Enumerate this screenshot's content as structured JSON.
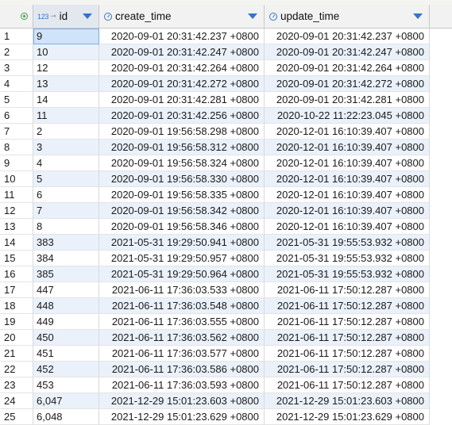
{
  "columns": [
    {
      "name": "id",
      "type_badge": "123"
    },
    {
      "name": "create_time"
    },
    {
      "name": "update_time"
    }
  ],
  "rows": [
    {
      "n": "1",
      "id": "9",
      "create": "2020-09-01 20:31:42.237 +0800",
      "update": "2020-09-01 20:31:42.237 +0800"
    },
    {
      "n": "2",
      "id": "10",
      "create": "2020-09-01 20:31:42.247 +0800",
      "update": "2020-09-01 20:31:42.247 +0800"
    },
    {
      "n": "3",
      "id": "12",
      "create": "2020-09-01 20:31:42.264 +0800",
      "update": "2020-09-01 20:31:42.264 +0800"
    },
    {
      "n": "4",
      "id": "13",
      "create": "2020-09-01 20:31:42.272 +0800",
      "update": "2020-09-01 20:31:42.272 +0800"
    },
    {
      "n": "5",
      "id": "14",
      "create": "2020-09-01 20:31:42.281 +0800",
      "update": "2020-09-01 20:31:42.281 +0800"
    },
    {
      "n": "6",
      "id": "11",
      "create": "2020-09-01 20:31:42.256 +0800",
      "update": "2020-10-22 11:22:23.045 +0800"
    },
    {
      "n": "7",
      "id": "2",
      "create": "2020-09-01 19:56:58.298 +0800",
      "update": "2020-12-01 16:10:39.407 +0800"
    },
    {
      "n": "8",
      "id": "3",
      "create": "2020-09-01 19:56:58.312 +0800",
      "update": "2020-12-01 16:10:39.407 +0800"
    },
    {
      "n": "9",
      "id": "4",
      "create": "2020-09-01 19:56:58.324 +0800",
      "update": "2020-12-01 16:10:39.407 +0800"
    },
    {
      "n": "10",
      "id": "5",
      "create": "2020-09-01 19:56:58.330 +0800",
      "update": "2020-12-01 16:10:39.407 +0800"
    },
    {
      "n": "11",
      "id": "6",
      "create": "2020-09-01 19:56:58.335 +0800",
      "update": "2020-12-01 16:10:39.407 +0800"
    },
    {
      "n": "12",
      "id": "7",
      "create": "2020-09-01 19:56:58.342 +0800",
      "update": "2020-12-01 16:10:39.407 +0800"
    },
    {
      "n": "13",
      "id": "8",
      "create": "2020-09-01 19:56:58.346 +0800",
      "update": "2020-12-01 16:10:39.407 +0800"
    },
    {
      "n": "14",
      "id": "383",
      "create": "2021-05-31 19:29:50.941 +0800",
      "update": "2021-05-31 19:55:53.932 +0800"
    },
    {
      "n": "15",
      "id": "384",
      "create": "2021-05-31 19:29:50.957 +0800",
      "update": "2021-05-31 19:55:53.932 +0800"
    },
    {
      "n": "16",
      "id": "385",
      "create": "2021-05-31 19:29:50.964 +0800",
      "update": "2021-05-31 19:55:53.932 +0800"
    },
    {
      "n": "17",
      "id": "447",
      "create": "2021-06-11 17:36:03.533 +0800",
      "update": "2021-06-11 17:50:12.287 +0800"
    },
    {
      "n": "18",
      "id": "448",
      "create": "2021-06-11 17:36:03.548 +0800",
      "update": "2021-06-11 17:50:12.287 +0800"
    },
    {
      "n": "19",
      "id": "449",
      "create": "2021-06-11 17:36:03.555 +0800",
      "update": "2021-06-11 17:50:12.287 +0800"
    },
    {
      "n": "20",
      "id": "450",
      "create": "2021-06-11 17:36:03.562 +0800",
      "update": "2021-06-11 17:50:12.287 +0800"
    },
    {
      "n": "21",
      "id": "451",
      "create": "2021-06-11 17:36:03.577 +0800",
      "update": "2021-06-11 17:50:12.287 +0800"
    },
    {
      "n": "22",
      "id": "452",
      "create": "2021-06-11 17:36:03.586 +0800",
      "update": "2021-06-11 17:50:12.287 +0800"
    },
    {
      "n": "23",
      "id": "453",
      "create": "2021-06-11 17:36:03.593 +0800",
      "update": "2021-06-11 17:50:12.287 +0800"
    },
    {
      "n": "24",
      "id": "6,047",
      "create": "2021-12-29 15:01:23.603 +0800",
      "update": "2021-12-29 15:01:23.603 +0800"
    },
    {
      "n": "25",
      "id": "6,048",
      "create": "2021-12-29 15:01:23.629 +0800",
      "update": "2021-12-29 15:01:23.629 +0800"
    }
  ],
  "icons": {
    "corner": "select-all-icon",
    "id_type": "numeric-type-icon",
    "key": "key-icon",
    "time_type": "clock-icon",
    "sort": "dropdown-arrow-icon"
  },
  "colors": {
    "accent": "#3574c8",
    "selected_cell": "#cfe3fb",
    "alt_row": "#eaf1fa"
  }
}
